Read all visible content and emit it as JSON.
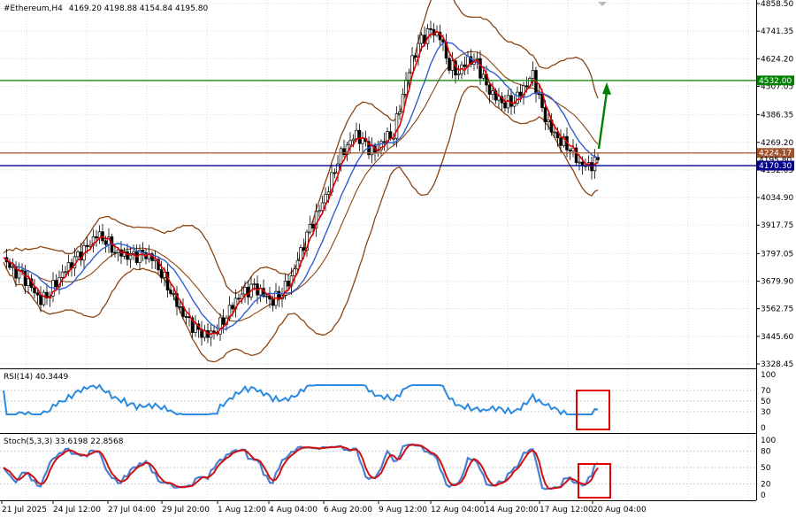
{
  "header": {
    "symbol": "#Ethereum,H4",
    "ohlc": "4169.20 4198.88 4154.84 4195.80"
  },
  "colors": {
    "bollinger": "#8b4513",
    "ma_fast": "#e00000",
    "ma_slow": "#2f5fd0",
    "rsi": "#2a8be0",
    "stoch_main": "#4a7fd0",
    "stoch_signal": "#d01010",
    "resistance": "#008000",
    "support": "#00008b",
    "level_mid": "#a0522d",
    "arrow": "#008000",
    "highlight_box": "#e00000",
    "candle": "#000000"
  },
  "price_axis": {
    "ticks": [
      "4858.50",
      "4741.35",
      "4624.20",
      "4507.05",
      "4386.35",
      "4269.20",
      "4152.05",
      "4034.90",
      "3917.75",
      "3797.05",
      "3679.90",
      "3562.75",
      "3445.60",
      "3328.45"
    ],
    "range": [
      3328.45,
      4858.5
    ]
  },
  "levels": {
    "resistance": {
      "value": 4532.0,
      "label": "4532.00"
    },
    "mid": {
      "value": 4224.17,
      "label": "4224.17"
    },
    "support": {
      "value": 4170.3,
      "label": "4170.30"
    },
    "current": {
      "label": "4195.80"
    }
  },
  "rsi": {
    "title": "RSI(14) 40.3449",
    "ticks": [
      "100",
      "70",
      "50",
      "30",
      "0"
    ]
  },
  "stoch": {
    "title": "Stoch(5,3,3) 33.6198 22.8568",
    "ticks": [
      "100",
      "80",
      "50",
      "20",
      "0"
    ]
  },
  "time_axis": {
    "labels": [
      "21 Jul 2025",
      "24 Jul 12:00",
      "27 Jul 04:00",
      "29 Jul 20:00",
      "1 Aug 12:00",
      "4 Aug 04:00",
      "6 Aug 20:00",
      "9 Aug 12:00",
      "12 Aug 04:00",
      "14 Aug 20:00",
      "17 Aug 12:00",
      "20 Aug 04:00"
    ]
  },
  "chart_data": {
    "type": "line",
    "title": "#Ethereum,H4",
    "series": [
      {
        "values": [
          3780,
          3720,
          3700,
          3650,
          3600,
          3640,
          3700,
          3740,
          3780,
          3820,
          3880,
          3860,
          3810,
          3790,
          3780,
          3790,
          3780,
          3720,
          3640,
          3560,
          3500,
          3460,
          3450,
          3480,
          3540,
          3600,
          3630,
          3650,
          3620,
          3600,
          3640,
          3700,
          3800,
          3900,
          3980,
          4080,
          4200,
          4260,
          4300,
          4250,
          4220,
          4290,
          4310,
          4480,
          4620,
          4700,
          4740,
          4720,
          4600,
          4570,
          4620,
          4600,
          4500,
          4460,
          4440,
          4450,
          4500,
          4550,
          4400,
          4320,
          4280,
          4250,
          4180,
          4160,
          4195
        ]
      }
    ],
    "ylim": [
      3328.45,
      4858.5
    ]
  }
}
